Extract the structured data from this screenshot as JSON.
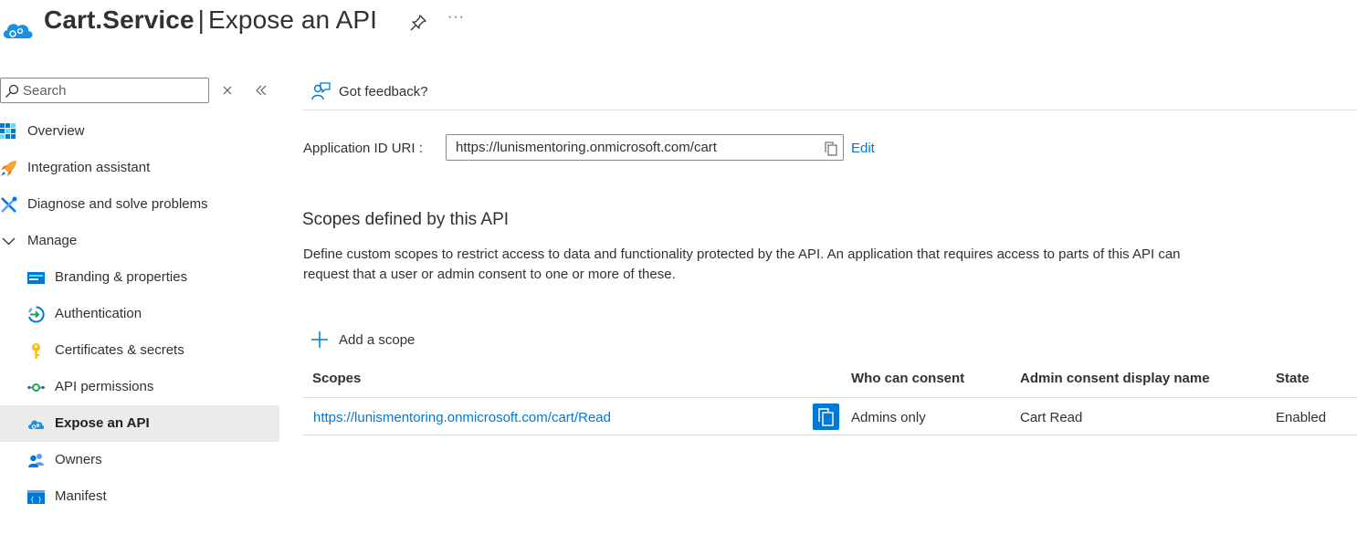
{
  "header": {
    "title_bold": "Cart.Service",
    "separator": "|",
    "title_rest": "Expose an API",
    "more": "···"
  },
  "sidebar": {
    "search": {
      "placeholder": "Search"
    },
    "items": [
      {
        "label": "Overview",
        "icon": "overview-grid-icon"
      },
      {
        "label": "Integration assistant",
        "icon": "rocket-icon"
      },
      {
        "label": "Diagnose and solve problems",
        "icon": "wrench-icon"
      },
      {
        "label": "Manage",
        "icon": "chevron-down-icon"
      },
      {
        "label": "Branding & properties",
        "icon": "branding-icon"
      },
      {
        "label": "Authentication",
        "icon": "authentication-icon"
      },
      {
        "label": "Certificates & secrets",
        "icon": "key-icon"
      },
      {
        "label": "API permissions",
        "icon": "api-permissions-icon"
      },
      {
        "label": "Expose an API",
        "icon": "cloud-gear-icon",
        "active": true
      },
      {
        "label": "Owners",
        "icon": "owners-icon"
      },
      {
        "label": "Manifest",
        "icon": "manifest-icon"
      }
    ]
  },
  "main": {
    "feedback_label": "Got feedback?",
    "app_id_uri": {
      "label": "Application ID URI :",
      "value": "https://lunismentoring.onmicrosoft.com/cart",
      "edit_label": "Edit"
    },
    "scopes_section": {
      "title": "Scopes defined by this API",
      "description": "Define custom scopes to restrict access to data and functionality protected by the API. An application that requires access to parts of this API can request that a user or admin consent to one or more of these.",
      "add_label": "Add a scope"
    },
    "table": {
      "headers": [
        "Scopes",
        "Who can consent",
        "Admin consent display name",
        "State"
      ],
      "rows": [
        {
          "scope": "https://lunismentoring.onmicrosoft.com/cart/Read",
          "who": "Admins only",
          "display_name": "Cart Read",
          "state": "Enabled"
        }
      ]
    }
  },
  "colors": {
    "accent": "#0078d4",
    "active_nav_bg": "#edebe9",
    "text": "#323130",
    "divider": "#e1dfdd"
  }
}
